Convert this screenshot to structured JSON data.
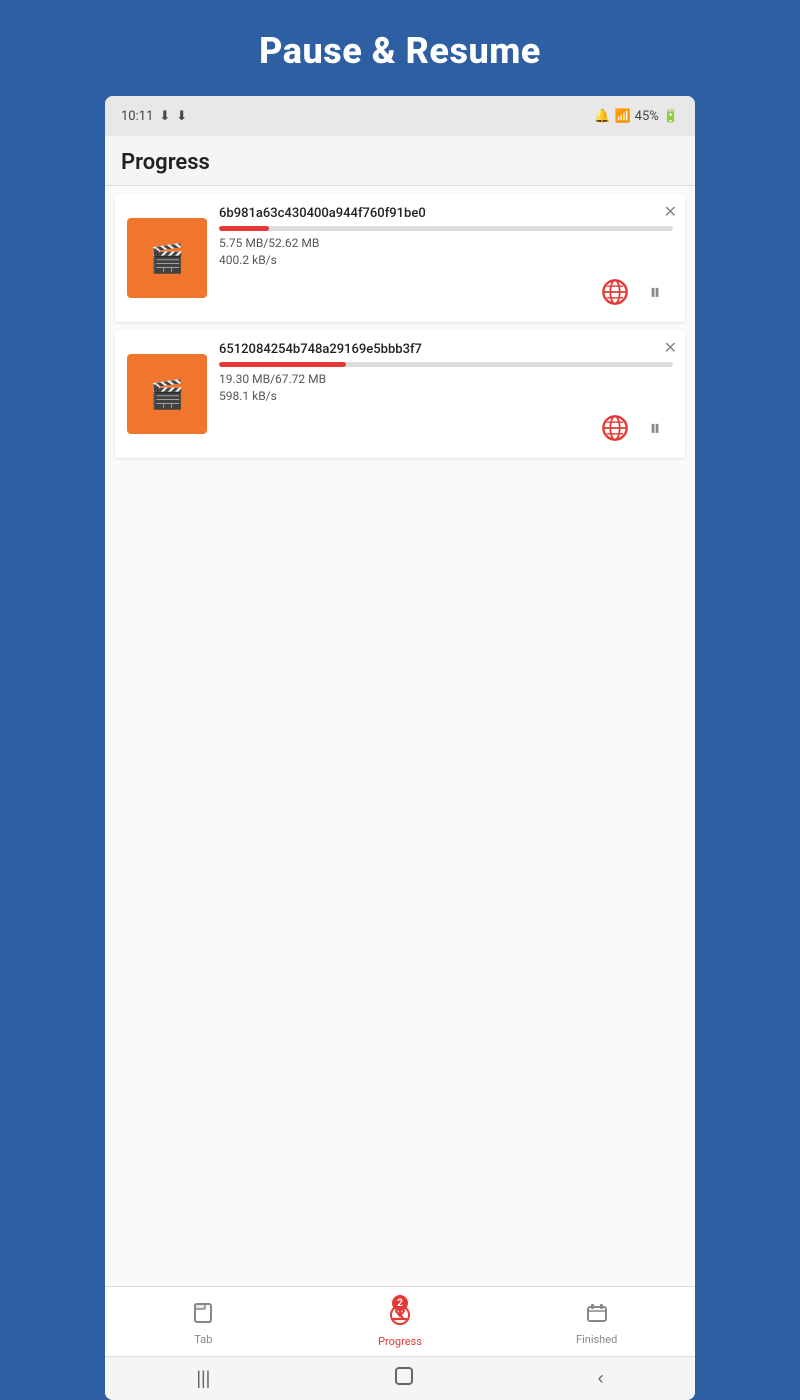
{
  "page": {
    "title": "Pause & Resume"
  },
  "status_bar": {
    "time": "10:11",
    "battery": "45%"
  },
  "app_bar": {
    "title": "Progress"
  },
  "downloads": [
    {
      "id": "download-1",
      "filename": "6b981a63c430400a944f760f91be0",
      "size_current": "5.75 MB",
      "size_total": "52.62 MB",
      "speed": "400.2 kB/s",
      "progress_percent": 11
    },
    {
      "id": "download-2",
      "filename": "6512084254b748a29169e5bbb3f7",
      "size_current": "19.30 MB",
      "size_total": "67.72 MB",
      "speed": "598.1 kB/s",
      "progress_percent": 28
    }
  ],
  "bottom_nav": {
    "items": [
      {
        "id": "tab",
        "label": "Tab",
        "active": false
      },
      {
        "id": "progress",
        "label": "Progress",
        "active": true,
        "badge": "2"
      },
      {
        "id": "finished",
        "label": "Finished",
        "active": false
      }
    ]
  }
}
